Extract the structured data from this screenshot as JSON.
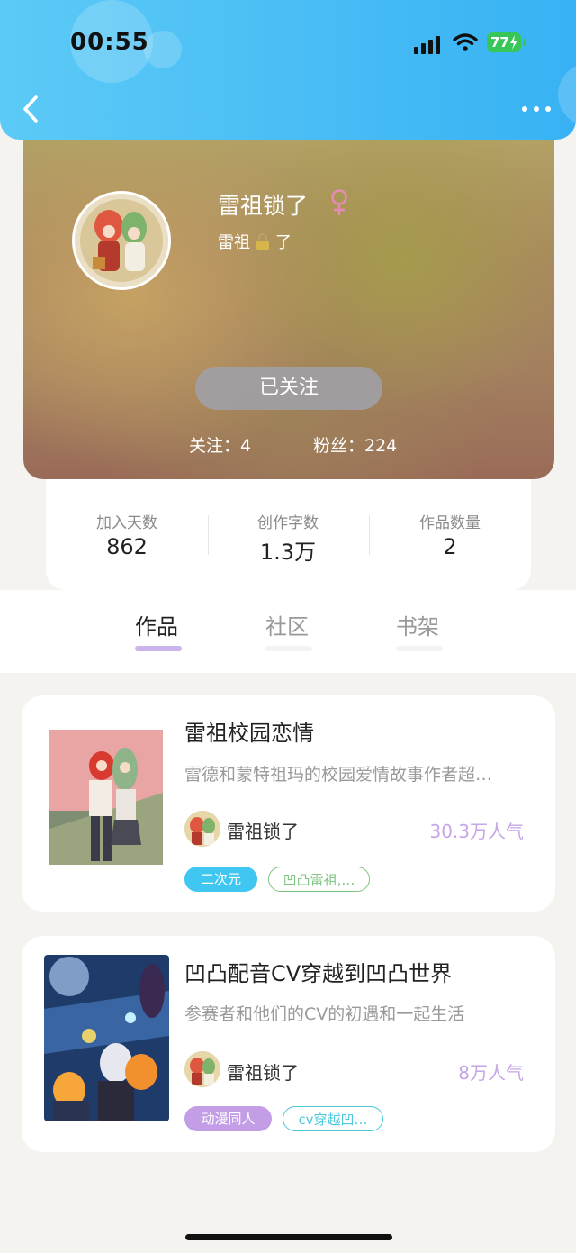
{
  "status_bar": {
    "time": "00:55",
    "battery": "77"
  },
  "profile": {
    "name": "雷祖锁了",
    "bio_left": "雷祖",
    "bio_right": "了",
    "follow_button": "已关注",
    "following_label": "关注：4",
    "followers_label": "粉丝：224"
  },
  "stats": [
    {
      "label": "加入天数",
      "value": "862"
    },
    {
      "label": "创作字数",
      "value": "1.3万"
    },
    {
      "label": "作品数量",
      "value": "2"
    }
  ],
  "tabs": [
    {
      "label": "作品",
      "active": true
    },
    {
      "label": "社区",
      "active": false
    },
    {
      "label": "书架",
      "active": false
    }
  ],
  "works": [
    {
      "title": "雷祖校园恋情",
      "description": "雷德和蒙特祖玛的校园爱情故事作者超…",
      "author": "雷祖锁了",
      "popularity": "30.3万人气",
      "tags": [
        "二次元",
        "凹凸雷祖,…"
      ]
    },
    {
      "title": "凹凸配音CV穿越到凹凸世界",
      "description": "参赛者和他们的CV的初遇和一起生活",
      "author": "雷祖锁了",
      "popularity": "8万人气",
      "tags": [
        "动漫同人",
        "cv穿越凹…"
      ]
    }
  ],
  "colors": {
    "header": "#38b2f4",
    "tab_active_indicator": "#c9b4ec",
    "popularity": "#c6a6e6",
    "tag_blue": "#3fc6f1",
    "tag_green": "#7cc47f",
    "tag_purple": "#c39ee6",
    "tag_cyan": "#49c8dc"
  }
}
